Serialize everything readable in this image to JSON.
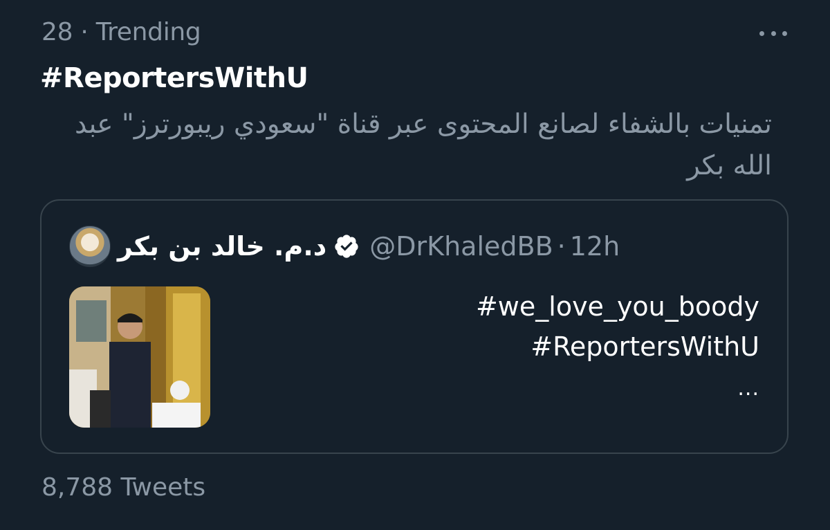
{
  "trend": {
    "rank": "28",
    "separator": "·",
    "category": "Trending",
    "hashtag": "#ReportersWithU",
    "description": "تمنيات بالشفاء لصانع المحتوى عبر قناة \"سعودي ريبورترز\" عبد الله بكر",
    "tweet_count": "8,788 Tweets"
  },
  "tweet": {
    "author_name": "د.م. خالد بن بكر",
    "handle": "@DrKhaledBB",
    "separator": "·",
    "time": "12h",
    "lines": [
      "#we_love_you_boody",
      "#ReportersWithU"
    ],
    "ellipsis": "..."
  },
  "icons": {
    "more": "more-horizontal-icon",
    "verified": "verified-badge-icon"
  },
  "colors": {
    "background": "#15202b",
    "text_primary": "#ffffff",
    "text_secondary": "#8b98a5",
    "border": "#38444d"
  }
}
